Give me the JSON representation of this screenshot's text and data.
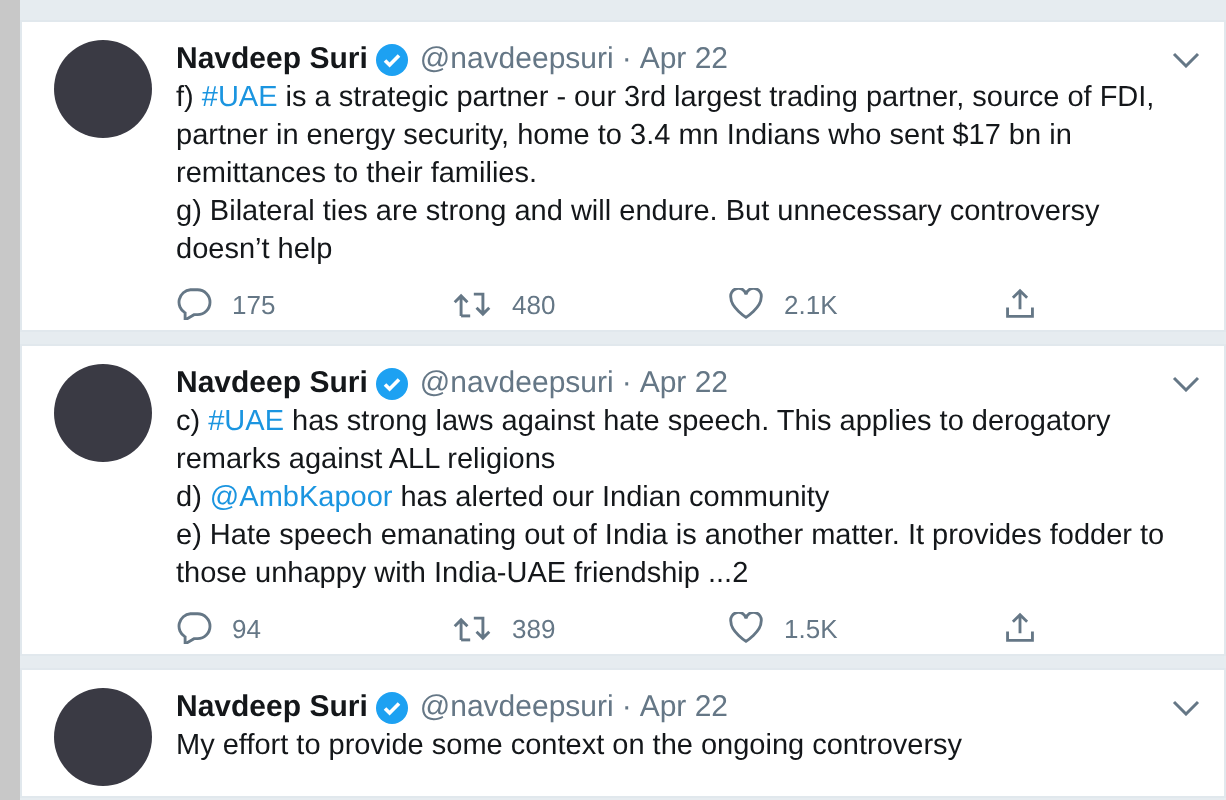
{
  "tweets": [
    {
      "name": "Navdeep Suri",
      "verified": true,
      "handle": "@navdeepsuri",
      "separator": "·",
      "date": "Apr 22",
      "paragraphs": [
        [
          {
            "kind": "text",
            "text": "f) "
          },
          {
            "kind": "hashtag",
            "text": "#UAE"
          },
          {
            "kind": "text",
            "text": " is a strategic partner - our 3rd largest trading partner, source of FDI, partner in energy security, home to 3.4 mn Indians who sent $17 bn in remittances to their families."
          }
        ],
        [
          {
            "kind": "text",
            "text": "g) Bilateral ties are strong and will endure. But unnecessary controversy doesn’t help"
          }
        ]
      ],
      "replies": "175",
      "retweets": "480",
      "likes": "2.1K"
    },
    {
      "name": "Navdeep Suri",
      "verified": true,
      "handle": "@navdeepsuri",
      "separator": "·",
      "date": "Apr 22",
      "paragraphs": [
        [
          {
            "kind": "text",
            "text": "c) "
          },
          {
            "kind": "hashtag",
            "text": "#UAE"
          },
          {
            "kind": "text",
            "text": " has strong laws against hate speech. This applies to derogatory remarks against ALL religions"
          }
        ],
        [
          {
            "kind": "text",
            "text": "d) "
          },
          {
            "kind": "mention",
            "text": "@AmbKapoor"
          },
          {
            "kind": "text",
            "text": " has alerted our Indian community"
          }
        ],
        [
          {
            "kind": "text",
            "text": "e) Hate speech emanating out of India is another matter. It provides fodder to those unhappy with India-UAE friendship ...2"
          }
        ]
      ],
      "replies": "94",
      "retweets": "389",
      "likes": "1.5K"
    },
    {
      "name": "Navdeep Suri",
      "verified": true,
      "handle": "@navdeepsuri",
      "separator": "·",
      "date": "Apr 22",
      "paragraphs": [
        [
          {
            "kind": "text",
            "text": "My effort to provide some context on the ongoing controversy"
          }
        ]
      ]
    }
  ]
}
